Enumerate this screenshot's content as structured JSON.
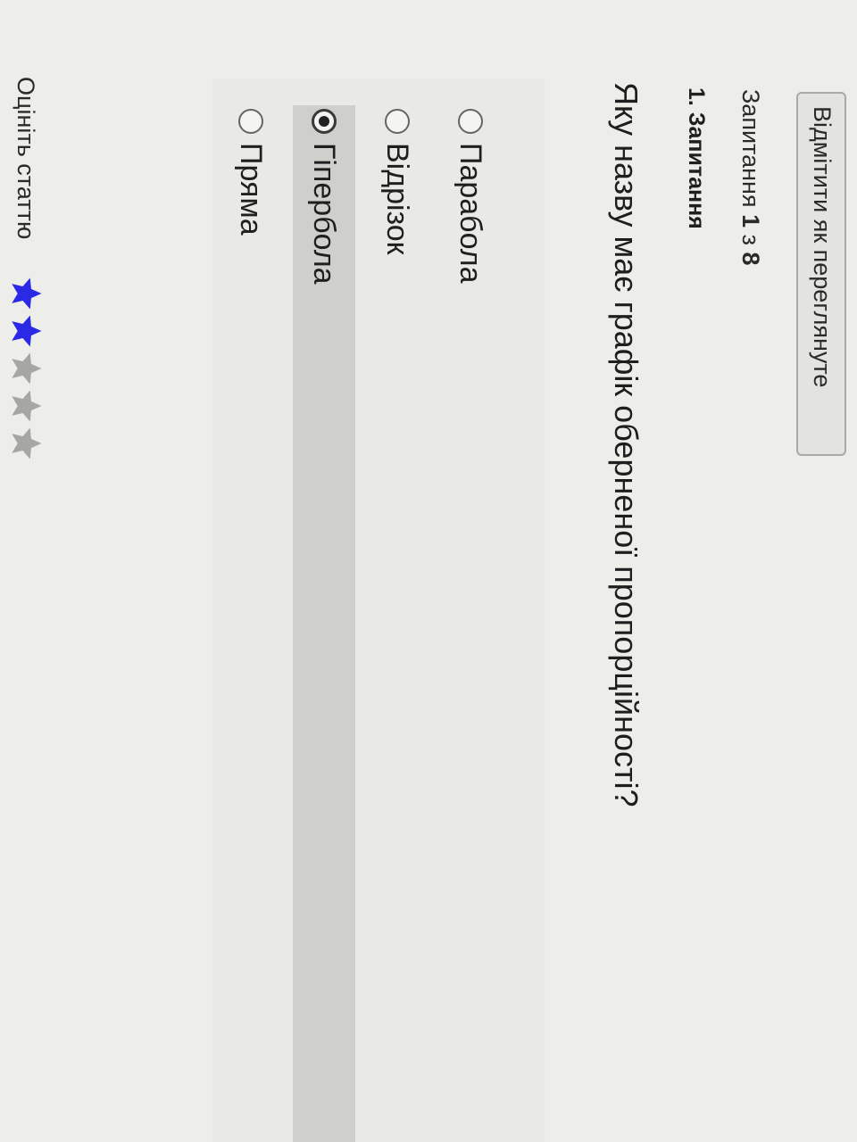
{
  "header": {
    "mark_button_label": "Відмітити як переглянуте",
    "counter_prefix": "Запитання",
    "counter_current": "1",
    "counter_sep": "з",
    "counter_total": "8"
  },
  "question": {
    "label": "1. Запитання",
    "text": "Яку назву має графік оберненої пропорційності?",
    "options": [
      {
        "label": "Парабола",
        "selected": false
      },
      {
        "label": "Відрізок",
        "selected": false
      },
      {
        "label": "Гіпербола",
        "selected": true
      },
      {
        "label": "Пряма",
        "selected": false
      }
    ]
  },
  "rating": {
    "label": "Оцініть статтю",
    "value": 2,
    "max": 5,
    "filled_color": "#2a2ae6",
    "empty_color": "#a6a6a3"
  }
}
